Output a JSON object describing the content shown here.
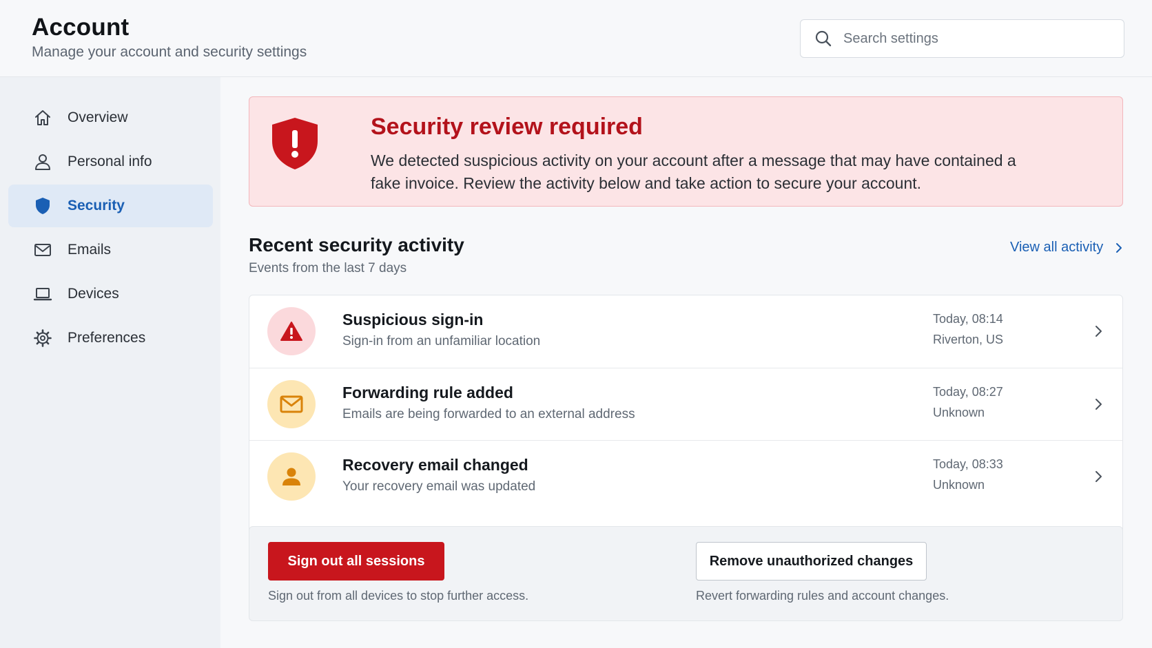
{
  "header": {
    "title": "Account",
    "subtitle": "Manage your account and security settings",
    "search": {
      "placeholder": "Search settings",
      "icon": "search-icon"
    }
  },
  "sidebar": {
    "items": [
      {
        "label": "Overview",
        "icon": "home-icon",
        "active": false
      },
      {
        "label": "Personal info",
        "icon": "user-icon",
        "active": false
      },
      {
        "label": "Security",
        "icon": "shield-icon",
        "active": true
      },
      {
        "label": "Emails",
        "icon": "mail-icon",
        "active": false
      },
      {
        "label": "Devices",
        "icon": "laptop-icon",
        "active": false
      },
      {
        "label": "Preferences",
        "icon": "gear-icon",
        "active": false
      }
    ]
  },
  "alert": {
    "title": "Security review required",
    "body": "We detected suspicious activity on your account after a message that may have contained a fake invoice. Review the activity below and take action to secure your account.",
    "icon": "shield-alert-icon",
    "color": "#c8161d"
  },
  "activity": {
    "title": "Recent security activity",
    "subtitle": "Events from the last 7 days",
    "view_all": "View all activity",
    "rows": [
      {
        "title": "Suspicious sign-in",
        "desc": "Sign-in from an unfamiliar location",
        "time": "Today, 08:14",
        "location": "Riverton, US",
        "icon": "warning-icon",
        "badge_color": "#fbd9dc"
      },
      {
        "title": "Forwarding rule added",
        "desc": "Emails are being forwarded to an external address",
        "time": "Today, 08:27",
        "location": "Unknown",
        "icon": "mail-icon",
        "badge_color": "#fde6b3"
      },
      {
        "title": "Recovery email changed",
        "desc": "Your recovery email was updated",
        "time": "Today, 08:33",
        "location": "Unknown",
        "icon": "person-icon",
        "badge_color": "#fde6b3"
      }
    ]
  },
  "actions": {
    "sign_out_label": "Sign out all sessions",
    "sign_out_note": "Sign out from all devices to stop further access.",
    "remove_label": "Remove unauthorized changes",
    "remove_note": "Revert forwarding rules and account changes."
  },
  "colors": {
    "accent": "#1a5fb4",
    "danger": "#c8161d",
    "warning": "#e3930c"
  }
}
